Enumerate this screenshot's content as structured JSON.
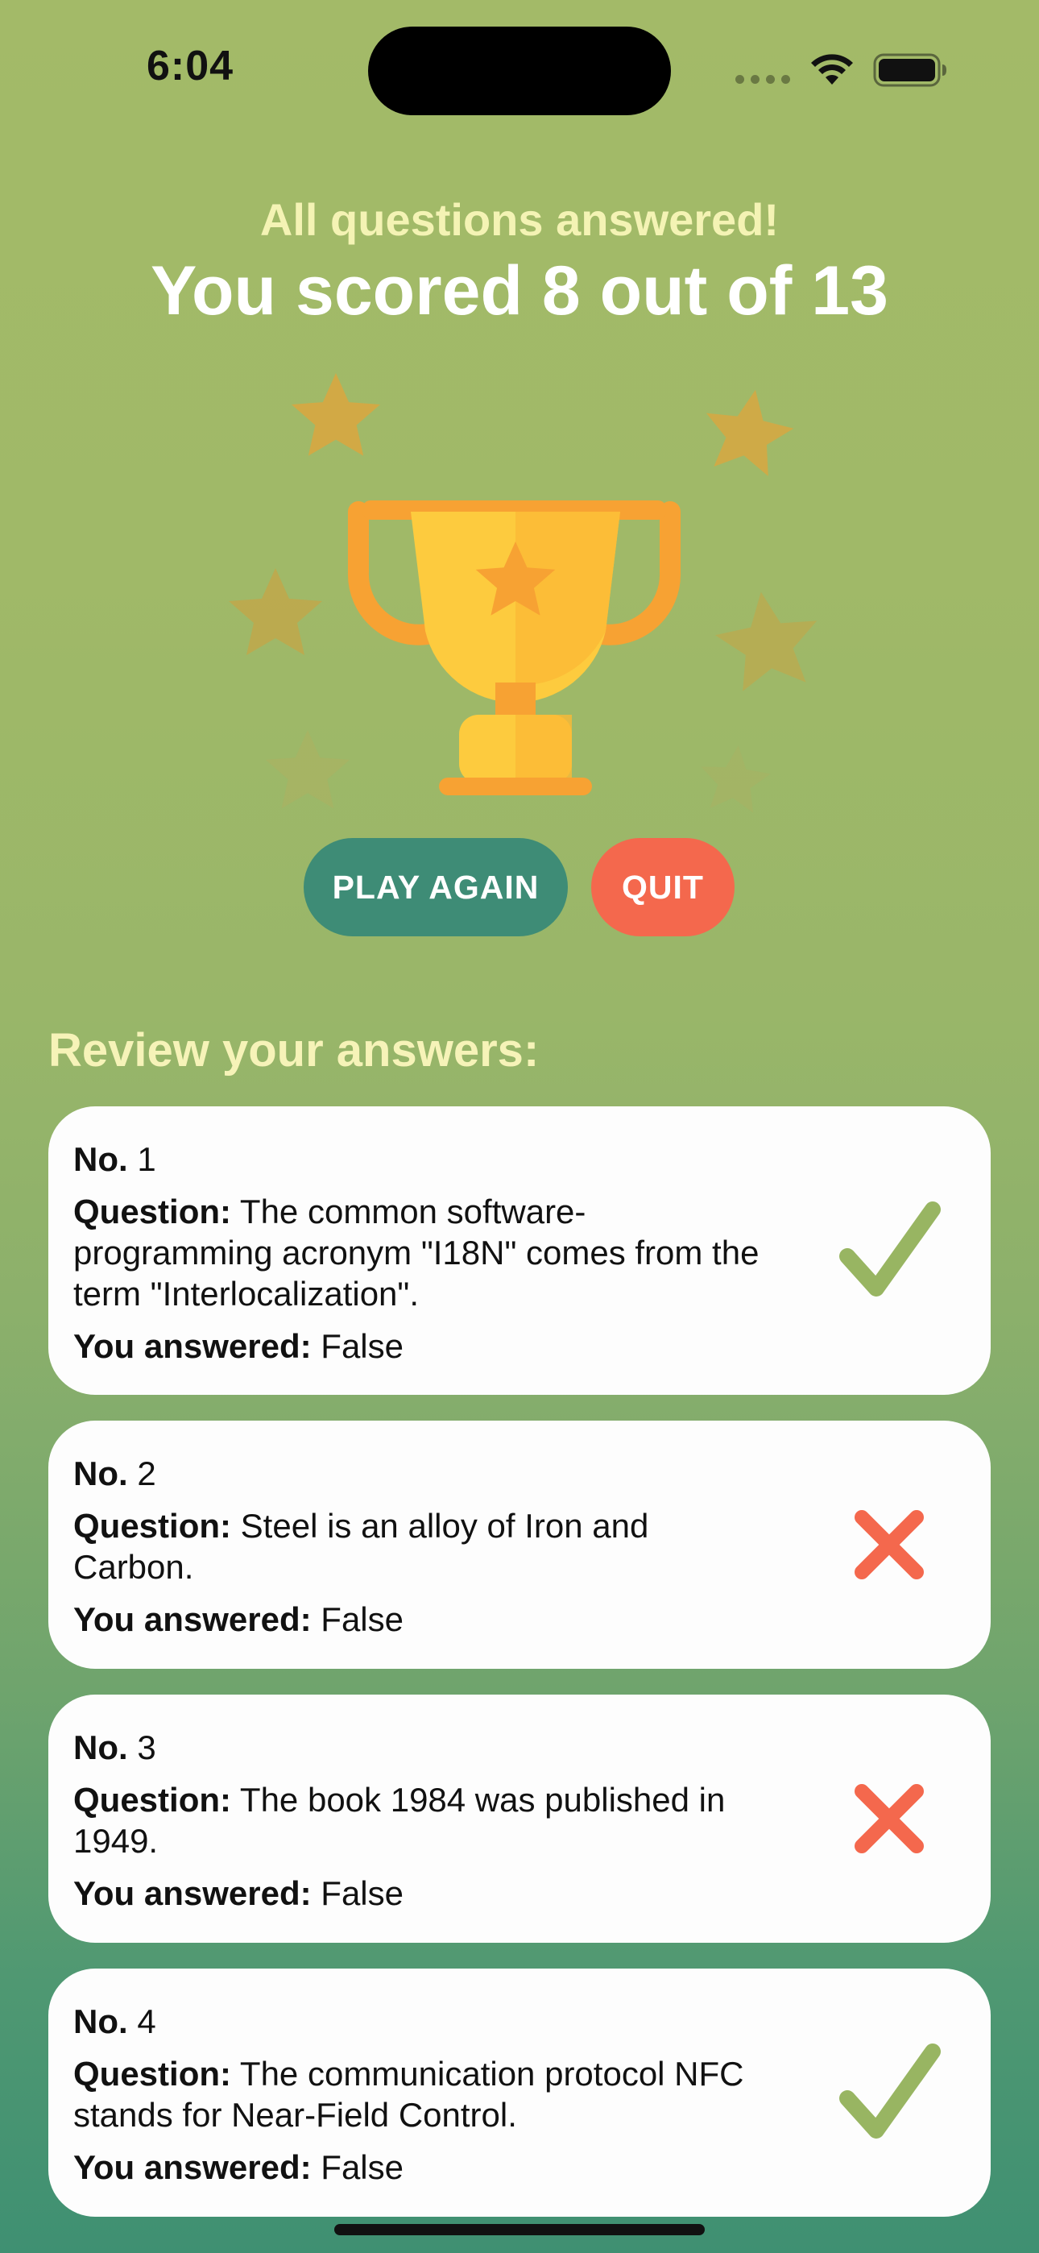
{
  "status_bar": {
    "time": "6:04"
  },
  "result": {
    "subtitle": "All questions answered!",
    "score_text": "You scored 8 out of 13"
  },
  "actions": {
    "play_again_label": "PLAY AGAIN",
    "quit_label": "QUIT"
  },
  "review": {
    "title": "Review your answers:",
    "labels": {
      "number": "No.",
      "question": "Question:",
      "answered": "You answered:"
    },
    "items": [
      {
        "number": "1",
        "question": "The common software-programming acronym \"I18N\" comes from the term \"Interlocalization\".",
        "answer": "False",
        "result": "correct"
      },
      {
        "number": "2",
        "question": "Steel is an alloy of Iron and Carbon.",
        "answer": "False",
        "result": "incorrect"
      },
      {
        "number": "3",
        "question": "The book 1984 was published in 1949.",
        "answer": "False",
        "result": "incorrect"
      },
      {
        "number": "4",
        "question": "The communication protocol NFC stands for Near-Field Control.",
        "answer": "False",
        "result": "correct"
      }
    ]
  },
  "icons": {
    "correct": "checkmark-icon",
    "incorrect": "cross-icon",
    "trophy": "trophy-icon",
    "star": "star-icon"
  },
  "colors": {
    "play_again": "#3e8c76",
    "quit": "#f4684d",
    "correct_mark": "#98b562",
    "incorrect_mark": "#f4684d",
    "subtitle": "#f4f3b4"
  }
}
